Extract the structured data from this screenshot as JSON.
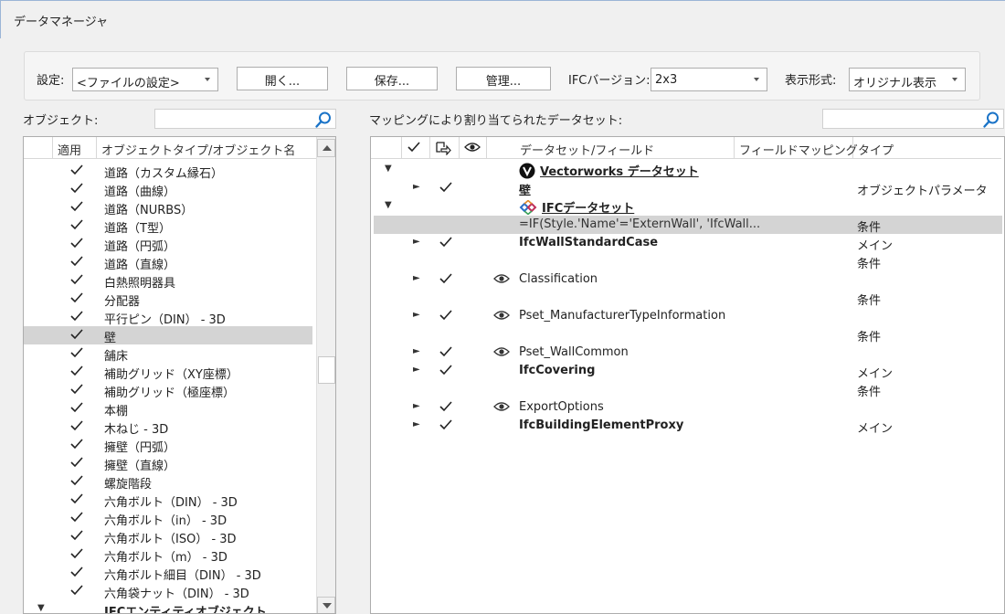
{
  "window": {
    "title": "データマネージャ"
  },
  "settings": {
    "label": "設定:",
    "value": "<ファイルの設定>",
    "open_label": "開く...",
    "save_label": "保存...",
    "manage_label": "管理...",
    "ifc_version_label": "IFCバージョン:",
    "ifc_version_value": "2x3",
    "display_label": "表示形式:",
    "display_value": "オリジナル表示"
  },
  "objects": {
    "label": "オブジェクト:",
    "search_value": "",
    "headers": {
      "apply": "適用",
      "name": "オブジェクトタイプ/オブジェクト名"
    },
    "rows": [
      {
        "name": "道路（カスタム縁石）",
        "checked": true
      },
      {
        "name": "道路（曲線）",
        "checked": true
      },
      {
        "name": "道路（NURBS）",
        "checked": true
      },
      {
        "name": "道路（T型）",
        "checked": true
      },
      {
        "name": "道路（円弧）",
        "checked": true
      },
      {
        "name": "道路（直線）",
        "checked": true
      },
      {
        "name": "白熱照明器具",
        "checked": true
      },
      {
        "name": "分配器",
        "checked": true
      },
      {
        "name": "平行ピン（DIN） - 3D",
        "checked": true
      },
      {
        "name": "壁",
        "checked": true,
        "selected": true
      },
      {
        "name": "舗床",
        "checked": true
      },
      {
        "name": "補助グリッド（XY座標）",
        "checked": true
      },
      {
        "name": "補助グリッド（極座標）",
        "checked": true
      },
      {
        "name": "本棚",
        "checked": true
      },
      {
        "name": "木ねじ - 3D",
        "checked": true
      },
      {
        "name": "擁壁（円弧）",
        "checked": true
      },
      {
        "name": "擁壁（直線）",
        "checked": true
      },
      {
        "name": "螺旋階段",
        "checked": true
      },
      {
        "name": "六角ボルト（DIN） - 3D",
        "checked": true
      },
      {
        "name": "六角ボルト（in） - 3D",
        "checked": true
      },
      {
        "name": "六角ボルト（ISO） - 3D",
        "checked": true
      },
      {
        "name": "六角ボルト（m） - 3D",
        "checked": true
      },
      {
        "name": "六角ボルト細目（DIN） - 3D",
        "checked": true
      },
      {
        "name": "六角袋ナット（DIN） - 3D",
        "checked": true
      },
      {
        "name": "IFCエンティティオブジェクト",
        "checked": false,
        "group": true
      }
    ]
  },
  "mapping": {
    "label": "マッピングにより割り当てられたデータセット:",
    "search_value": "",
    "headers": {
      "dataset": "データセット/フィールド",
      "field_mapping": "フィールドマッピング",
      "type": "タイプ"
    },
    "rows": [
      {
        "expand": "down",
        "checked": false,
        "eye": false,
        "text": "Vectorworks データセット",
        "style": "link",
        "icon": "vectorworks-logo-icon",
        "type": ""
      },
      {
        "expand": "right",
        "checked": true,
        "eye": false,
        "text": "壁",
        "style": "bold",
        "type": "オブジェクトパラメータ"
      },
      {
        "expand": "down",
        "checked": false,
        "eye": false,
        "text": "IFCデータセット",
        "style": "link",
        "icon": "ifc-logo-icon",
        "type": ""
      },
      {
        "expand": "",
        "checked": false,
        "eye": false,
        "text": "=IF(Style.'Name'='ExternWall', 'IfcWall...",
        "style": "plain",
        "type": "条件",
        "selected": true
      },
      {
        "expand": "right",
        "checked": true,
        "eye": false,
        "text": "IfcWallStandardCase",
        "style": "bold",
        "type": "メイン"
      },
      {
        "expand": "",
        "checked": false,
        "eye": false,
        "text": "",
        "style": "plain",
        "type": "条件"
      },
      {
        "expand": "right",
        "checked": true,
        "eye": true,
        "text": "Classification",
        "style": "plain",
        "type": ""
      },
      {
        "expand": "",
        "checked": false,
        "eye": false,
        "text": "",
        "style": "plain",
        "type": "条件"
      },
      {
        "expand": "right",
        "checked": true,
        "eye": true,
        "text": "Pset_ManufacturerTypeInformation",
        "style": "plain",
        "type": ""
      },
      {
        "expand": "",
        "checked": false,
        "eye": false,
        "text": "",
        "style": "plain",
        "type": "条件"
      },
      {
        "expand": "right",
        "checked": true,
        "eye": true,
        "text": "Pset_WallCommon",
        "style": "plain",
        "type": ""
      },
      {
        "expand": "right",
        "checked": true,
        "eye": false,
        "text": "IfcCovering",
        "style": "bold",
        "type": "メイン"
      },
      {
        "expand": "",
        "checked": false,
        "eye": false,
        "text": "",
        "style": "plain",
        "type": "条件"
      },
      {
        "expand": "right",
        "checked": true,
        "eye": true,
        "text": "ExportOptions",
        "style": "plain",
        "type": ""
      },
      {
        "expand": "right",
        "checked": true,
        "eye": false,
        "text": "IfcBuildingElementProxy",
        "style": "bold",
        "type": "メイン"
      }
    ]
  },
  "colors": {
    "selection": "#d4d4d4",
    "accent": "#1a73c7",
    "ifc_logo": "#c0305a"
  }
}
